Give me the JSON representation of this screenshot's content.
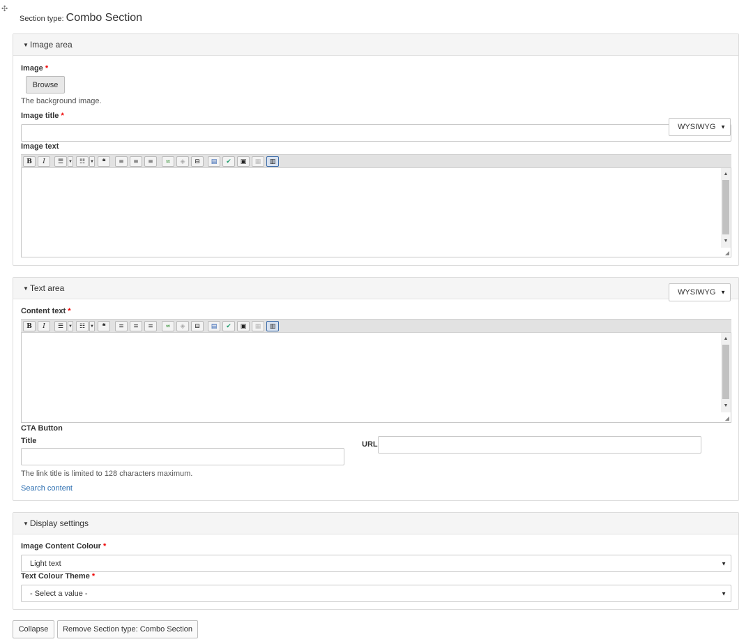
{
  "header": {
    "section_type_label": "Section type:",
    "section_type_value": "Combo Section"
  },
  "image_area": {
    "legend": "Image area",
    "image_label": "Image",
    "browse_label": "Browse",
    "image_desc": "The background image.",
    "image_title_label": "Image title",
    "text_format_value": "WYSIWYG",
    "image_text_label": "Image text"
  },
  "text_area": {
    "legend": "Text area",
    "text_format_value": "WYSIWYG",
    "content_text_label": "Content text",
    "cta_label": "CTA Button",
    "title_label": "Title",
    "url_label": "URL",
    "title_desc": "The link title is limited to 128 characters maximum.",
    "search_link": "Search content"
  },
  "display_settings": {
    "legend": "Display settings",
    "image_colour_label": "Image Content Colour",
    "image_colour_value": "Light text",
    "text_theme_label": "Text Colour Theme",
    "text_theme_value": "- Select a value -"
  },
  "footer": {
    "collapse_label": "Collapse",
    "remove_label": "Remove Section type: Combo Section"
  },
  "toolbar_icons": [
    "bold-icon",
    "italic-icon",
    "bullet-list-icon",
    "numbered-list-icon",
    "blockquote-icon",
    "align-left-icon",
    "align-center-icon",
    "align-right-icon",
    "link-icon",
    "unlink-icon",
    "page-break-icon",
    "template-icon",
    "spellcheck-icon",
    "image-icon",
    "table-icon",
    "show-blocks-icon"
  ]
}
